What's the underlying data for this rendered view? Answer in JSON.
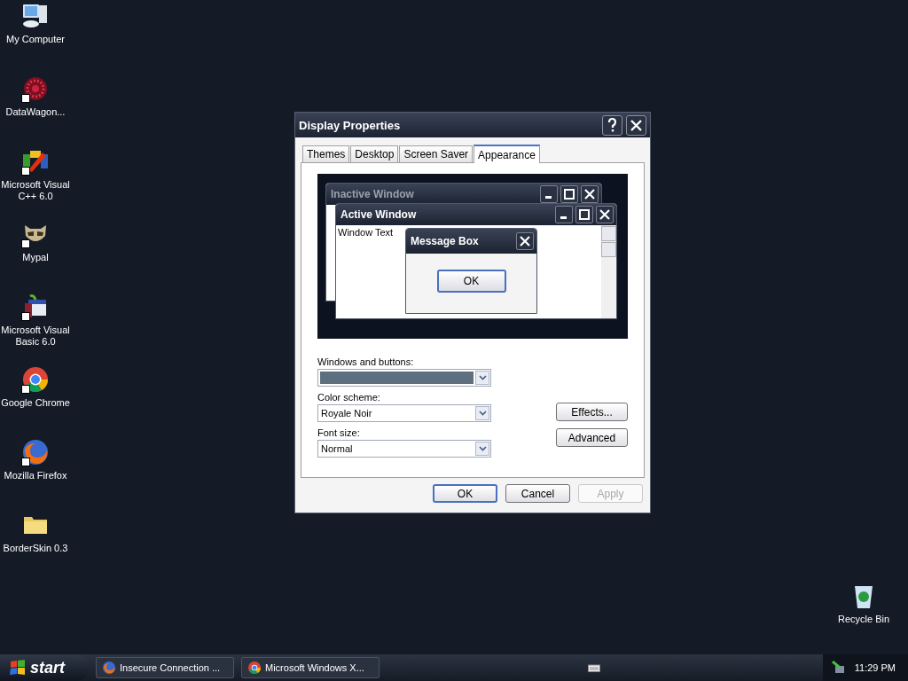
{
  "desktop_icons": [
    {
      "label": "My Computer",
      "kind": "computer",
      "shortcut": false
    },
    {
      "label": "DataWagon...",
      "kind": "web",
      "shortcut": true
    },
    {
      "label": "Microsoft Visual C++ 6.0",
      "kind": "vcpp",
      "shortcut": true
    },
    {
      "label": "Mypal",
      "kind": "raccoon",
      "shortcut": true
    },
    {
      "label": "Microsoft Visual Basic 6.0",
      "kind": "vb",
      "shortcut": true
    },
    {
      "label": "Google Chrome",
      "kind": "chrome",
      "shortcut": true
    },
    {
      "label": "Mozilla Firefox",
      "kind": "firefox",
      "shortcut": true
    },
    {
      "label": "BorderSkin 0.3",
      "kind": "folder",
      "shortcut": false
    }
  ],
  "recycle_bin": {
    "label": "Recycle Bin"
  },
  "dialog": {
    "title": "Display Properties",
    "tabs": [
      {
        "label": "Themes",
        "selected": false
      },
      {
        "label": "Desktop",
        "selected": false
      },
      {
        "label": "Screen Saver",
        "selected": false
      },
      {
        "label": "Appearance",
        "selected": true
      }
    ],
    "preview": {
      "inactive_title": "Inactive Window",
      "active_title": "Active Window",
      "window_text": "Window Text",
      "message_title": "Message Box",
      "message_button": "OK"
    },
    "fields": [
      {
        "label": "Windows and buttons:",
        "kind": "swatch"
      },
      {
        "label": "Color scheme:",
        "kind": "text",
        "value": "Royale Noir"
      },
      {
        "label": "Font size:",
        "kind": "text",
        "value": "Normal"
      }
    ],
    "side_buttons": [
      "Effects...",
      "Advanced"
    ],
    "footer_buttons": [
      {
        "label": "OK",
        "default": true,
        "disabled": false
      },
      {
        "label": "Cancel",
        "default": false,
        "disabled": false
      },
      {
        "label": "Apply",
        "default": false,
        "disabled": true
      }
    ]
  },
  "taskbar": {
    "start": "start",
    "tasks": [
      {
        "label": "Insecure Connection ...",
        "kind": "firefox"
      },
      {
        "label": "Microsoft Windows X...",
        "kind": "chrome"
      }
    ],
    "clock": "11:29 PM"
  }
}
